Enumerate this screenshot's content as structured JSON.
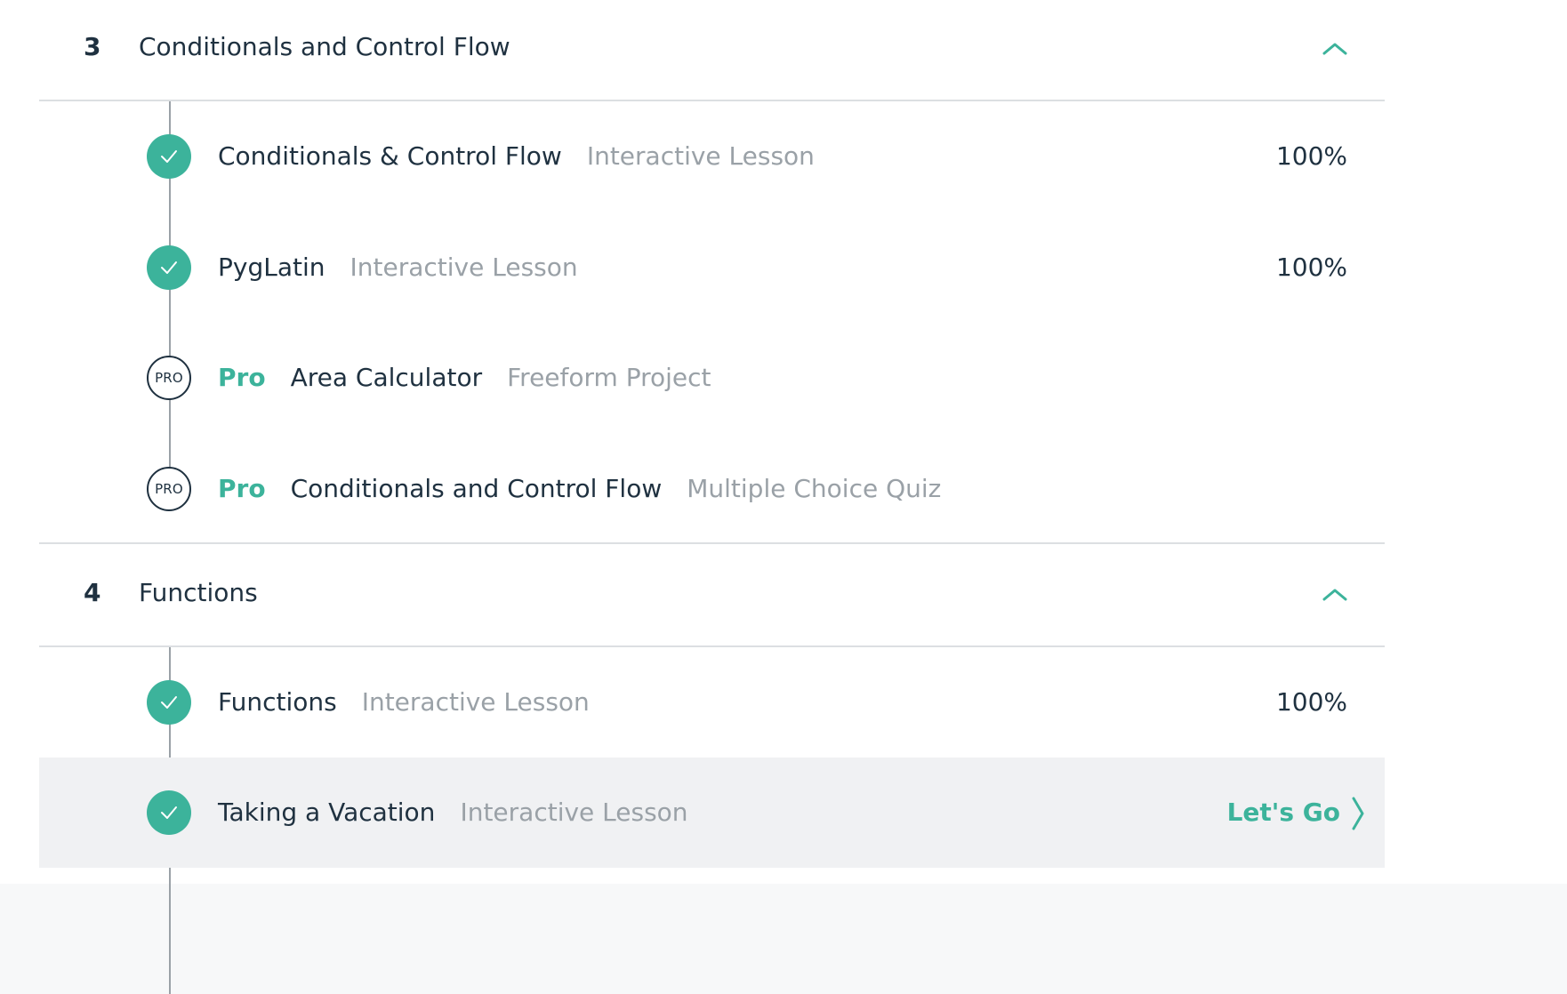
{
  "sections": [
    {
      "number": "3",
      "title": "Conditionals and Control Flow",
      "lessons": [
        {
          "title": "Conditionals & Control Flow",
          "type": "Interactive Lesson",
          "progress": "100%",
          "status": "complete"
        },
        {
          "title": "PygLatin",
          "type": "Interactive Lesson",
          "progress": "100%",
          "status": "complete"
        },
        {
          "pro_label": "Pro",
          "badge": "PRO",
          "title": "Area Calculator",
          "type": "Freeform Project",
          "status": "pro"
        },
        {
          "pro_label": "Pro",
          "badge": "PRO",
          "title": "Conditionals and Control Flow",
          "type": "Multiple Choice Quiz",
          "status": "pro"
        }
      ]
    },
    {
      "number": "4",
      "title": "Functions",
      "lessons": [
        {
          "title": "Functions",
          "type": "Interactive Lesson",
          "progress": "100%",
          "status": "complete"
        },
        {
          "title": "Taking a Vacation",
          "type": "Interactive Lesson",
          "cta": "Let's Go",
          "status": "complete-current"
        }
      ]
    }
  ],
  "colors": {
    "accent": "#3cb39b",
    "text": "#1f3140",
    "muted": "#9aa1a7",
    "highlight_row": "#f0f1f3"
  },
  "icons": {
    "collapse": "chevron-up-icon",
    "complete": "checkmark-icon",
    "cta_arrow": "chevron-right-icon"
  }
}
